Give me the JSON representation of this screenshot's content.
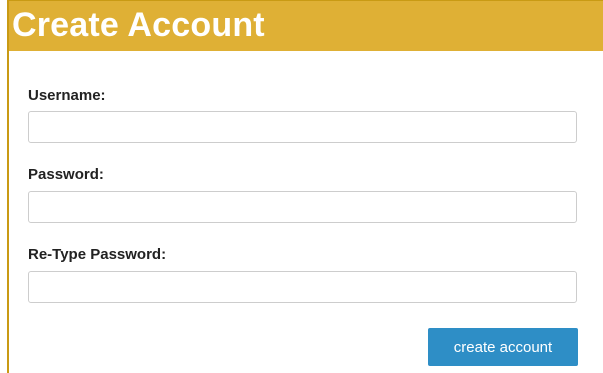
{
  "form": {
    "title": "Create Account",
    "username_label": "Username:",
    "username_value": "",
    "password_label": "Password:",
    "password_value": "",
    "retype_label": "Re-Type Password:",
    "retype_value": "",
    "submit_label": "create account"
  },
  "colors": {
    "header_bg": "#dfb035",
    "button_bg": "#2e8ec6"
  }
}
